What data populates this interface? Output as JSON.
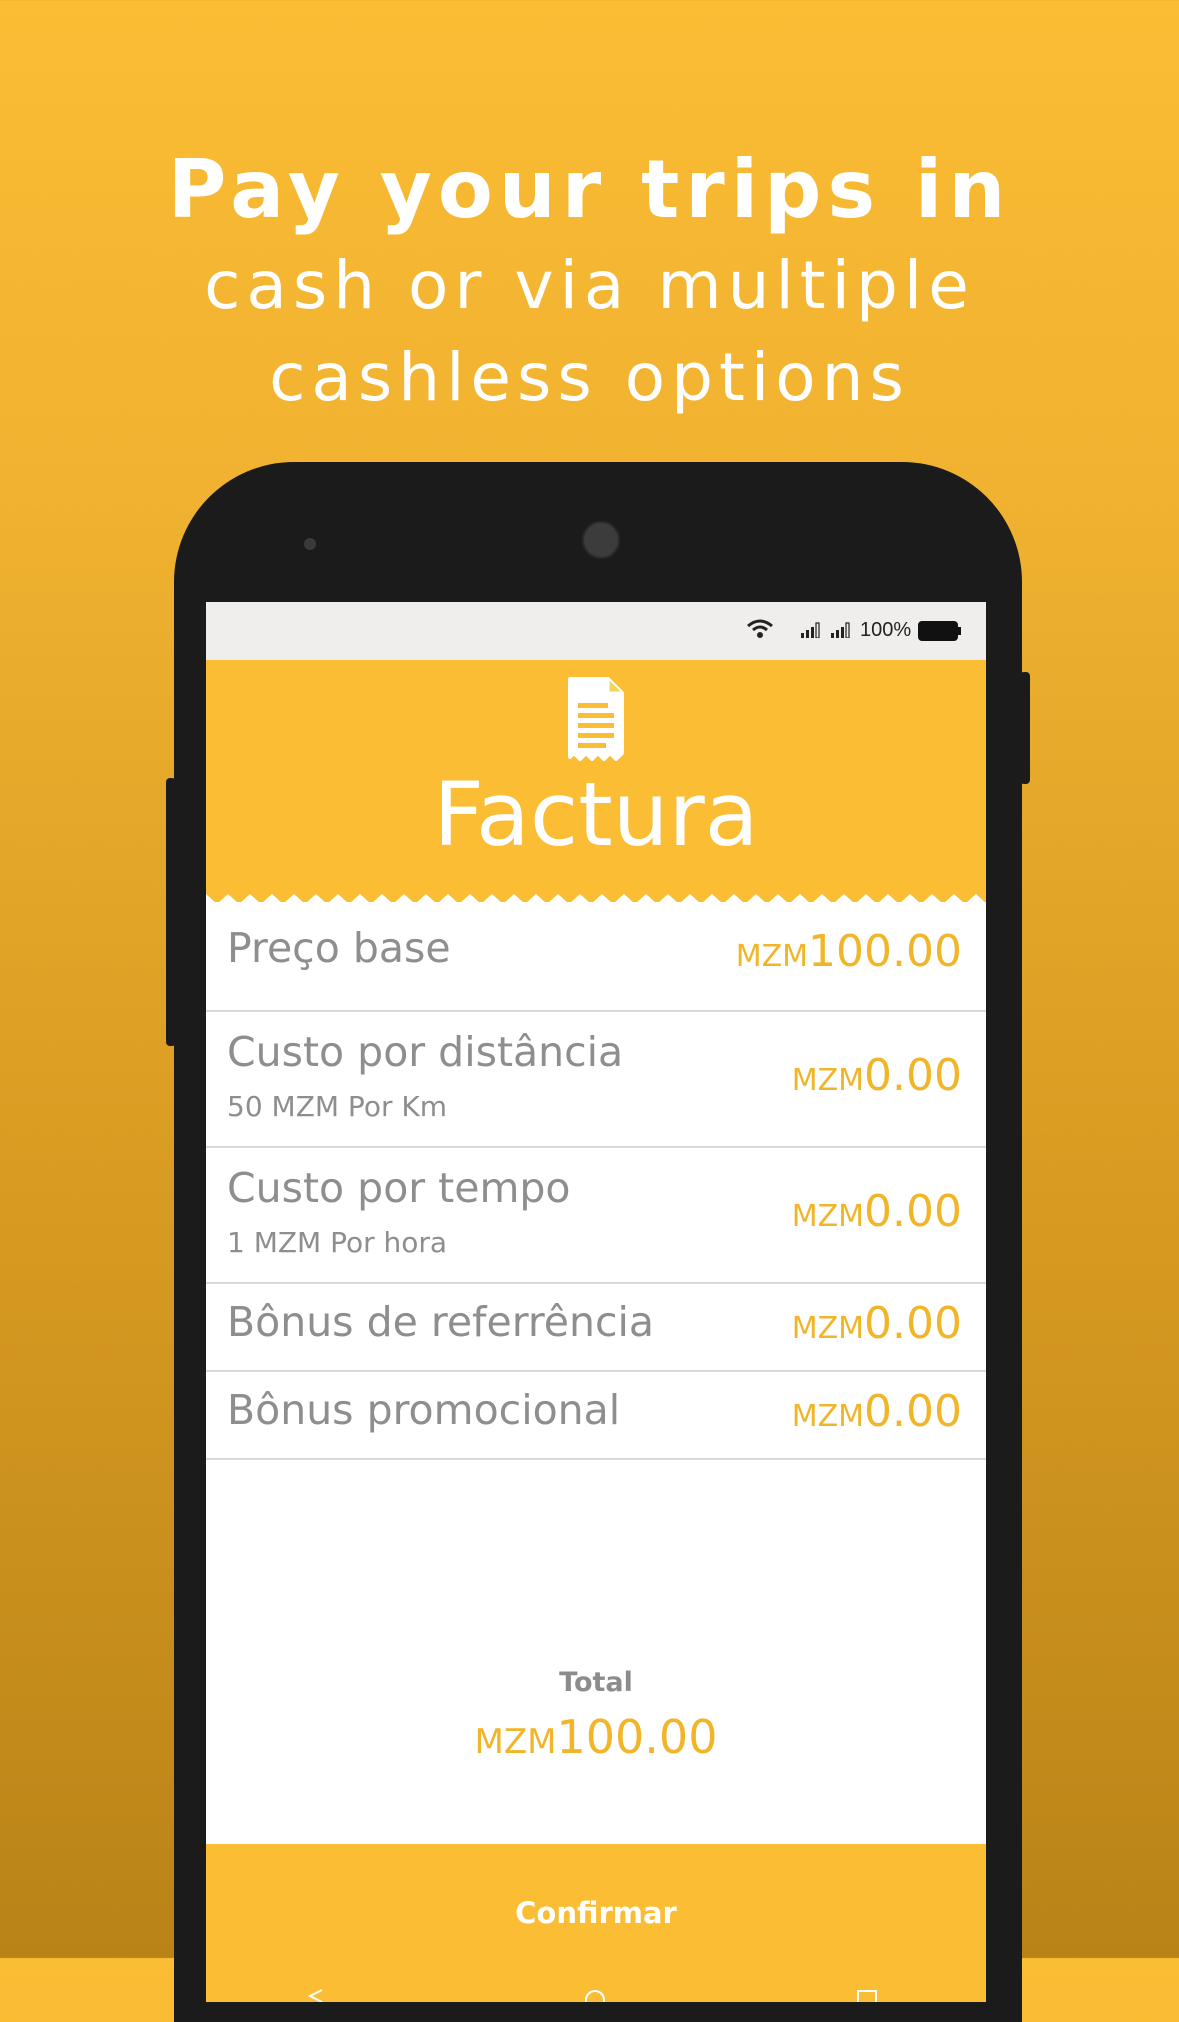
{
  "headline": {
    "line1": "Pay your trips in",
    "line2": "cash or via multiple",
    "line3": "cashless options"
  },
  "status_bar": {
    "battery_text": "100%",
    "icons": [
      "wifi-icon",
      "signal-icon",
      "signal-icon",
      "battery-icon"
    ]
  },
  "invoice": {
    "icon": "receipt-icon",
    "title": "Factura",
    "rows": [
      {
        "label": "Preço base",
        "sub": "",
        "currency": "MZM",
        "amount": "100.00"
      },
      {
        "label": "Custo por distância",
        "sub": "50 MZM Por Km",
        "currency": "MZM",
        "amount": "0.00"
      },
      {
        "label": "Custo por tempo",
        "sub": "1 MZM Por hora",
        "currency": "MZM",
        "amount": "0.00"
      },
      {
        "label": "Bônus de referrência",
        "sub": "",
        "currency": "MZM",
        "amount": "0.00"
      },
      {
        "label": "Bônus promocional",
        "sub": "",
        "currency": "MZM",
        "amount": "0.00"
      }
    ],
    "total": {
      "label": "Total",
      "currency": "MZM",
      "amount": "100.00"
    },
    "confirm_label": "Confirmar"
  },
  "colors": {
    "accent": "#fbbd34",
    "amount_text": "#f1b529",
    "label_text": "#8e8e8e",
    "phone_body": "#1b1b1b"
  }
}
